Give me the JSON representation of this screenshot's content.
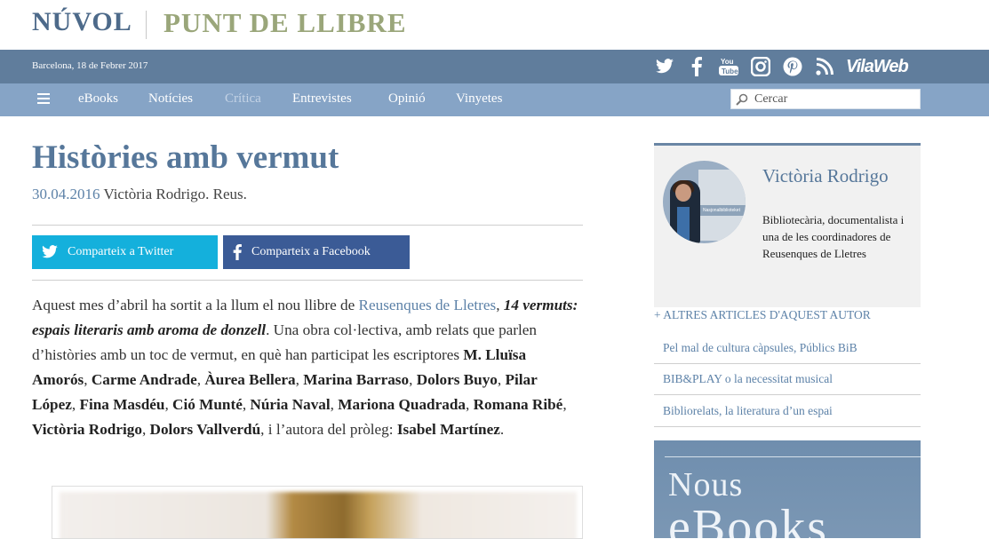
{
  "brand": {
    "left": "NÚVOL",
    "right": "PUNT DE LLIBRE"
  },
  "topbar": {
    "date": "Barcelona, 18 de Febrer 2017",
    "socials": [
      "twitter-icon",
      "facebook-icon",
      "youtube-icon",
      "instagram-icon",
      "pinterest-icon",
      "rss-icon"
    ],
    "youtube_text": "You Tube",
    "partner": "VilaWeb"
  },
  "nav": {
    "items": [
      {
        "label": "eBooks",
        "active": false
      },
      {
        "label": "Notícies",
        "active": false
      },
      {
        "label": "Crítica",
        "active": true
      },
      {
        "label": "Entrevistes",
        "active": false
      },
      {
        "label": "Opinió",
        "active": false
      },
      {
        "label": "Vinyetes",
        "active": false
      }
    ],
    "search_placeholder": "Cercar"
  },
  "article": {
    "title": "Històries amb vermut",
    "date": "30.04.2016",
    "byline": "Victòria Rodrigo. Reus.",
    "share_twitter": "Comparteix a Twitter",
    "share_facebook": "Comparteix a Facebook",
    "p1": "Aquest mes d’abril ha sortit a la llum el nou llibre de ",
    "link": "Reusenques de Lletres",
    "comma": ", ",
    "book_title": "14 vermuts: espais literaris amb aroma de donzell",
    "p2": ". Una obra col·lectiva, amb relats que parlen d’històries amb un toc de vermut, en què han participat les escriptores ",
    "authors": [
      "M. Lluïsa Amorós",
      "Carme Andrade",
      "Àurea Bellera",
      "Marina Barraso",
      "Dolors Buyo",
      "Pilar López",
      "Fina Masdéu",
      "Ció Munté",
      "Núria Naval",
      "Mariona Quadrada",
      "Romana Ribé",
      "Victòria Rodrigo",
      "Dolors Vallverdú"
    ],
    "p3": ", i l’autora del pròleg: ",
    "prologue": "Isabel Martínez",
    "end": "."
  },
  "sidebar": {
    "author_name": "Victòria Rodrigo",
    "author_bio": "Bibliotecària, documentalista i una de les coordinadores de Reusenques de Lletres",
    "more_label": "+ ALTRES ARTICLES D'AQUEST AUTOR",
    "related": [
      "Pel mal de cultura càpsules, Públics BiB",
      "BIB&PLAY o la necessitat musical",
      "Bibliorelats, la literatura d’un espai"
    ],
    "promo_line1": "Nous",
    "promo_line2": "eBooks"
  },
  "colors": {
    "topbar": "#607d9c",
    "navbar": "#86a4c6",
    "twitter": "#14b0dc",
    "facebook": "#3b5b96",
    "link": "#5d82a8"
  }
}
